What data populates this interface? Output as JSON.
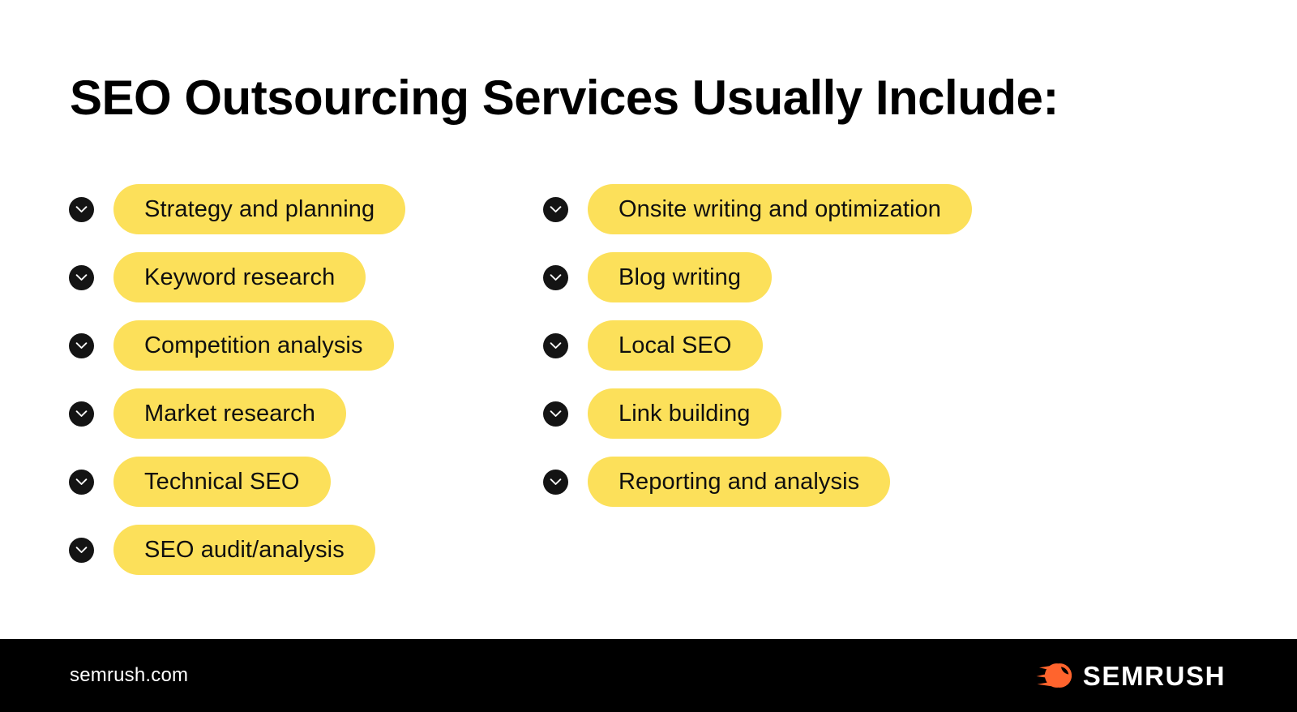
{
  "page": {
    "title": "SEO Outsourcing Services Usually Include:",
    "background_color": "#FFFFFF"
  },
  "theme": {
    "pill_color": "#FCE05A",
    "icon_color": "#141414",
    "text_color": "#0F0F0F",
    "footer_background": "#000000",
    "footer_text_color": "#FFFFFF",
    "brand_accent": "#FF642D"
  },
  "icons": {
    "check_circle": "check-circle-chevron-icon",
    "semrush_mark": "semrush-comet-logo-icon"
  },
  "columns": {
    "left": [
      {
        "label": "Strategy and planning",
        "icon": "check-circle-chevron-icon"
      },
      {
        "label": "Keyword research",
        "icon": "check-circle-chevron-icon"
      },
      {
        "label": "Competition analysis",
        "icon": "check-circle-chevron-icon"
      },
      {
        "label": "Market research",
        "icon": "check-circle-chevron-icon"
      },
      {
        "label": "Technical SEO",
        "icon": "check-circle-chevron-icon"
      },
      {
        "label": "SEO audit/analysis",
        "icon": "check-circle-chevron-icon"
      }
    ],
    "right": [
      {
        "label": "Onsite writing and optimization",
        "icon": "check-circle-chevron-icon"
      },
      {
        "label": "Blog writing",
        "icon": "check-circle-chevron-icon"
      },
      {
        "label": "Local SEO",
        "icon": "check-circle-chevron-icon"
      },
      {
        "label": "Link building",
        "icon": "check-circle-chevron-icon"
      },
      {
        "label": "Reporting and analysis",
        "icon": "check-circle-chevron-icon"
      }
    ]
  },
  "footer": {
    "url": "semrush.com",
    "brand_name": "SEMRUSH"
  }
}
